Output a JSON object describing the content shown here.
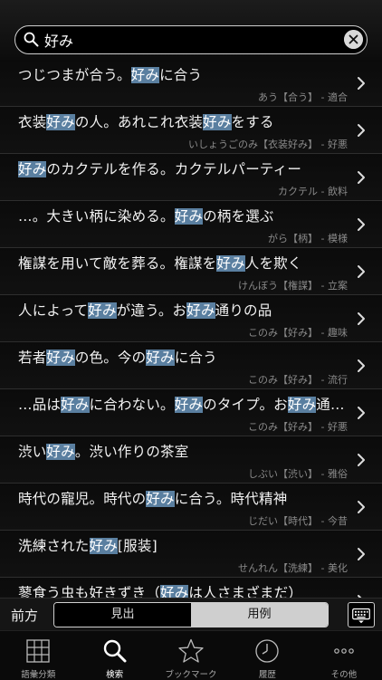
{
  "search": {
    "value": "好み",
    "placeholder": ""
  },
  "results": [
    {
      "parts": [
        "つじつまが合う。",
        "好み",
        "に合う"
      ],
      "sub": "あう【合う】 - 適合"
    },
    {
      "parts": [
        "衣装",
        "好み",
        "の人。あれこれ衣装",
        "好み",
        "をする"
      ],
      "sub": "いしょうごのみ【衣装好み】 - 好悪"
    },
    {
      "parts": [
        "",
        "好み",
        "のカクテルを作る。カクテルパーティー"
      ],
      "sub": "カクテル - 飲料"
    },
    {
      "parts": [
        "…。大きい柄に染める。",
        "好み",
        "の柄を選ぶ"
      ],
      "sub": "がら【柄】 - 模様"
    },
    {
      "parts": [
        "権謀を用いて敵を葬る。権謀を",
        "好み",
        "人を欺く"
      ],
      "sub": "けんぼう【権謀】 - 立案"
    },
    {
      "parts": [
        "人によって",
        "好み",
        "が違う。お",
        "好み",
        "通りの品"
      ],
      "sub": "このみ【好み】 - 趣味"
    },
    {
      "parts": [
        "若者",
        "好み",
        "の色。今の",
        "好み",
        "に合う"
      ],
      "sub": "このみ【好み】 - 流行"
    },
    {
      "parts": [
        "…品は",
        "好み",
        "に合わない。",
        "好み",
        "のタイプ。お",
        "好み",
        "通…"
      ],
      "sub": "このみ【好み】 - 好悪"
    },
    {
      "parts": [
        "渋い",
        "好み",
        "。渋い作りの茶室"
      ],
      "sub": "しぶい【渋い】 - 雅俗"
    },
    {
      "parts": [
        "時代の寵児。時代の",
        "好み",
        "に合う。時代精神"
      ],
      "sub": "じだい【時代】 - 今昔"
    },
    {
      "parts": [
        "洗練された",
        "好み",
        "[服装]"
      ],
      "sub": "せんれん【洗練】 - 美化"
    },
    {
      "parts": [
        "蓼食う虫も好きずき（",
        "好み",
        "は人さまざまだ）"
      ],
      "sub": ""
    }
  ],
  "controls": {
    "direction_label": "前方",
    "segments": [
      "見出",
      "用例"
    ],
    "selected_segment": "用例"
  },
  "tabs": [
    {
      "label": "語彙分類",
      "icon": "grid-icon"
    },
    {
      "label": "検索",
      "icon": "search-icon",
      "active": true
    },
    {
      "label": "ブックマーク",
      "icon": "star-icon"
    },
    {
      "label": "履歴",
      "icon": "clock-icon"
    },
    {
      "label": "その他",
      "icon": "more-icon"
    }
  ],
  "colors": {
    "highlight": "#5a7fa0",
    "background": "#000000",
    "subtext": "#8a8a8a"
  }
}
